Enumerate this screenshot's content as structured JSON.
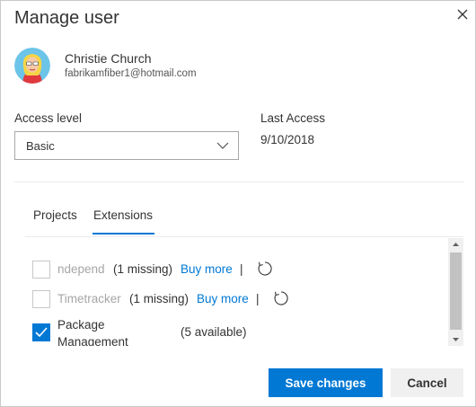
{
  "dialog": {
    "title": "Manage user",
    "close_icon": "close-icon"
  },
  "user": {
    "name": "Christie Church",
    "email": "fabrikamfiber1@hotmail.com"
  },
  "access_level": {
    "label": "Access level",
    "value": "Basic"
  },
  "last_access": {
    "label": "Last Access",
    "value": "9/10/2018"
  },
  "tabs": [
    {
      "label": "Projects",
      "active": false
    },
    {
      "label": "Extensions",
      "active": true
    }
  ],
  "extensions": [
    {
      "name": "ndepend",
      "status": "(1 missing)",
      "action": "Buy more",
      "separator": "|",
      "checked": false
    },
    {
      "name": "Timetracker",
      "status": "(1 missing)",
      "action": "Buy more",
      "separator": "|",
      "checked": false
    },
    {
      "name": "Package Management",
      "status": "(5 available)",
      "checked": true
    }
  ],
  "footer": {
    "save_label": "Save changes",
    "cancel_label": "Cancel"
  },
  "colors": {
    "accent": "#0078d4",
    "disabled_text": "#a6a6a6"
  }
}
